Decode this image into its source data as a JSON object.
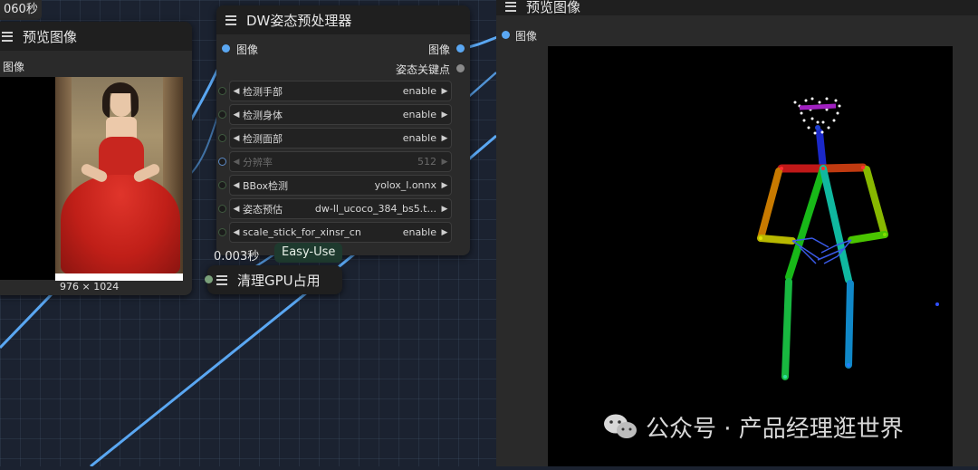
{
  "top_timer": "060秒",
  "preview_left": {
    "title": "预览图像",
    "port_label": "图像",
    "image_size": "976 × 1024"
  },
  "dw_node": {
    "title": "DW姿态预处理器",
    "input_label": "图像",
    "output_image": "图像",
    "output_keypoints": "姿态关键点",
    "widgets": [
      {
        "label": "检测手部",
        "value": "enable",
        "disabled": false
      },
      {
        "label": "检测身体",
        "value": "enable",
        "disabled": false
      },
      {
        "label": "检测面部",
        "value": "enable",
        "disabled": false
      },
      {
        "label": "分辨率",
        "value": "512",
        "disabled": true
      },
      {
        "label": "BBox检测",
        "value": "yolox_l.onnx",
        "disabled": false
      },
      {
        "label": "姿态预估",
        "value": "dw-ll_ucoco_384_bs5.t...",
        "disabled": false
      },
      {
        "label": "scale_stick_for_xinsr_cn",
        "value": "enable",
        "disabled": false
      }
    ]
  },
  "clean_gpu_node": {
    "timer": "0.003秒",
    "badge": "Easy-Use",
    "title": "清理GPU占用"
  },
  "preview_right": {
    "title": "预览图像",
    "port_label": "图像"
  },
  "watermark": {
    "text": "公众号 · 产品经理逛世界",
    "icon": "wechat-icon"
  },
  "colors": {
    "link_blue": "#5aa7f2",
    "node_bg": "#2a2a2a",
    "title_bg": "#1f1f1f",
    "badge_bg": "#1e3a2e"
  }
}
